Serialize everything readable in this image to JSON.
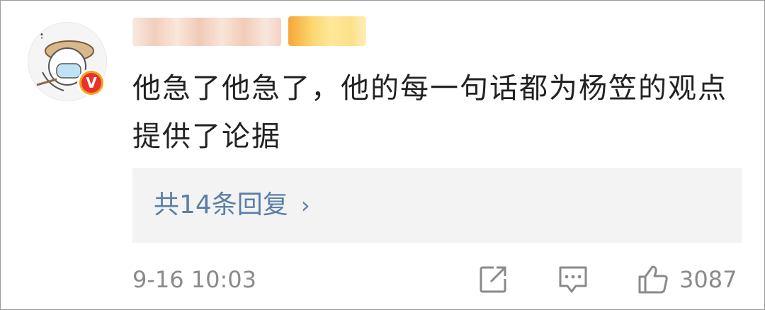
{
  "comment": {
    "text": "他急了他急了，他的每一句话都为杨笠的观点提供了论据",
    "verified_badge": "V"
  },
  "replies": {
    "label": "共14条回复",
    "chevron": "›"
  },
  "meta": {
    "timestamp": "9-16 10:03",
    "like_count": "3087"
  },
  "icons": {
    "share": "share-icon",
    "comment": "comment-icon",
    "like": "thumbs-up-icon"
  },
  "colors": {
    "link": "#5b7fa6",
    "badge_red": "#e8322b",
    "badge_orange": "#f6a417"
  }
}
